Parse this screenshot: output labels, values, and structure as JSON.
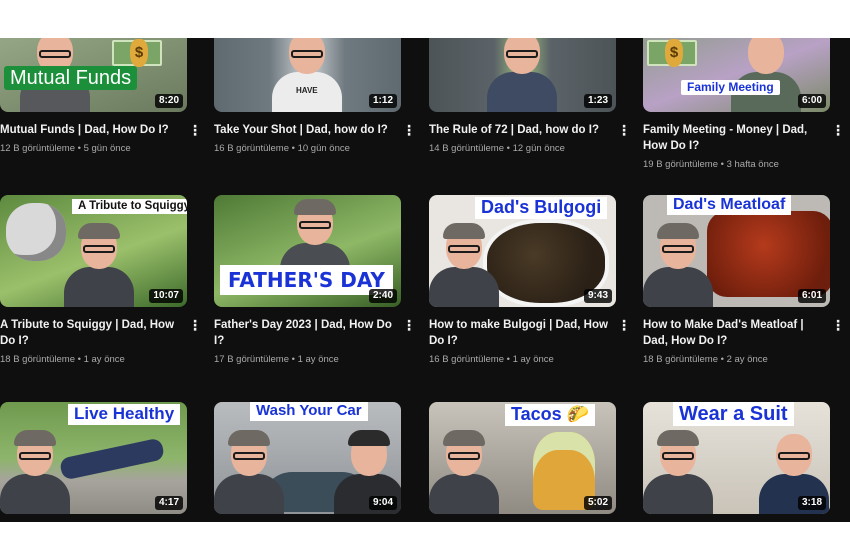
{
  "videos": [
    {
      "title": "Mutual Funds | Dad, How Do I?",
      "stats": "12 B görüntüleme • 5 gün önce",
      "duration": "8:20",
      "overlay": "Mutual Funds",
      "shirt_text": ""
    },
    {
      "title": "Take Your Shot | Dad, how do I?",
      "stats": "16 B görüntüleme • 10 gün önce",
      "duration": "1:12",
      "overlay": "",
      "shirt_text": "HAVE"
    },
    {
      "title": "The Rule of 72 | Dad, how do I?",
      "stats": "14 B görüntüleme • 12 gün önce",
      "duration": "1:23",
      "overlay": "",
      "shirt_text": ""
    },
    {
      "title": "Family Meeting - Money | Dad, How Do I?",
      "stats": "19 B görüntüleme • 3 hafta önce",
      "duration": "6:00",
      "overlay": "Family Meeting",
      "shirt_text": ""
    },
    {
      "title": "A Tribute to Squiggy | Dad, How Do I?",
      "stats": "18 B görüntüleme • 1 ay önce",
      "duration": "10:07",
      "overlay": "A Tribute to Squiggy",
      "shirt_text": ""
    },
    {
      "title": "Father's Day 2023 | Dad, How Do I?",
      "stats": "17 B görüntüleme • 1 ay önce",
      "duration": "2:40",
      "overlay": "FATHER'S DAY",
      "shirt_text": ""
    },
    {
      "title": "How to make Bulgogi | Dad, How Do I?",
      "stats": "16 B görüntüleme • 1 ay önce",
      "duration": "9:43",
      "overlay": "Dad's Bulgogi",
      "shirt_text": ""
    },
    {
      "title": "How to Make Dad's Meatloaf | Dad, How Do I?",
      "stats": "18 B görüntüleme • 2 ay önce",
      "duration": "6:01",
      "overlay": "Dad's Meatloaf",
      "shirt_text": ""
    },
    {
      "title": "",
      "stats": "",
      "duration": "4:17",
      "overlay": "Live Healthy",
      "shirt_text": ""
    },
    {
      "title": "",
      "stats": "",
      "duration": "9:04",
      "overlay": "Wash Your Car",
      "shirt_text": ""
    },
    {
      "title": "",
      "stats": "",
      "duration": "5:02",
      "overlay": "Tacos 🌮",
      "shirt_text": ""
    },
    {
      "title": "",
      "stats": "",
      "duration": "3:18",
      "overlay": "Wear a Suit",
      "shirt_text": ""
    }
  ],
  "menu_glyph": "⋮",
  "dollar_glyph": "$",
  "colors": {
    "page_bg": "#0f0f0f",
    "title_text": "#f1f1f1",
    "meta_text": "#aaaaaa",
    "overlay_blue": "#1a33d6",
    "overlay_green": "#1b8f3a"
  }
}
